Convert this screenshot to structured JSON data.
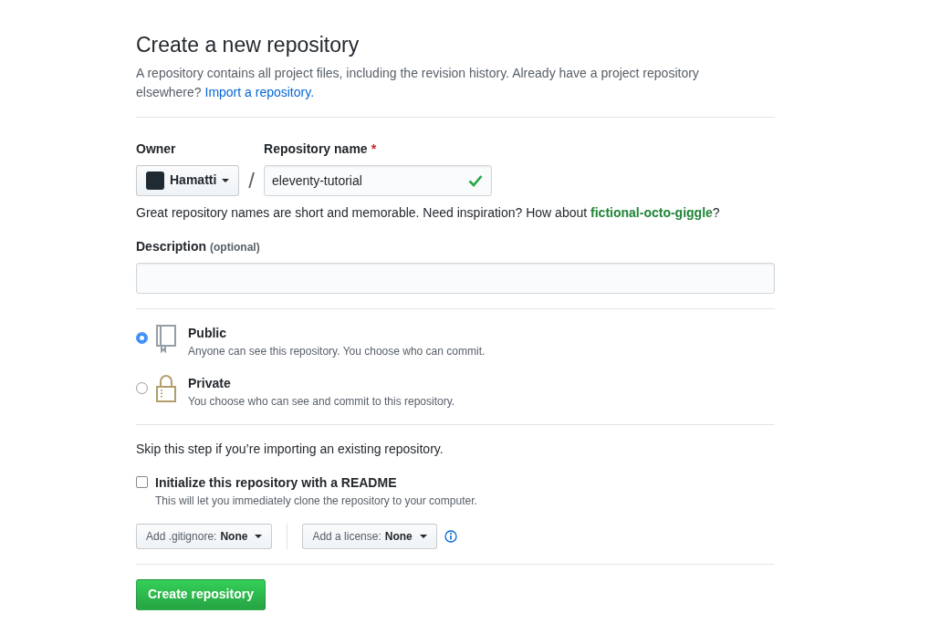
{
  "header": {
    "title": "Create a new repository",
    "intro": "A repository contains all project files, including the revision history. Already have a project repository elsewhere?",
    "intro_link": "Import a repository."
  },
  "owner": {
    "label": "Owner",
    "value": "Hamatti"
  },
  "separator": "/",
  "repo_name": {
    "label": "Repository name",
    "required_mark": "*",
    "value": "eleventy-tutorial",
    "valid": true
  },
  "name_hint": {
    "text": "Great repository names are short and memorable. Need inspiration? How about",
    "suggestion": "fictional-octo-giggle",
    "suffix": "?"
  },
  "description": {
    "label": "Description",
    "hint": "(optional)"
  },
  "visibility": [
    {
      "kind": "public",
      "title": "Public",
      "text": "Anyone can see this repository. You choose who can commit.",
      "selected": true
    },
    {
      "kind": "private",
      "title": "Private",
      "text": "You choose who can see and commit to this repository.",
      "selected": false
    }
  ],
  "import_note": "Skip this step if you’re importing an existing repository.",
  "readme": {
    "title": "Initialize this repository with a README",
    "text": "This will let you immediately clone the repository to your computer.",
    "checked": false
  },
  "gitignore": {
    "label": "Add .gitignore:",
    "value": "None"
  },
  "license": {
    "label": "Add a license:",
    "value": "None"
  },
  "submit": "Create repository"
}
